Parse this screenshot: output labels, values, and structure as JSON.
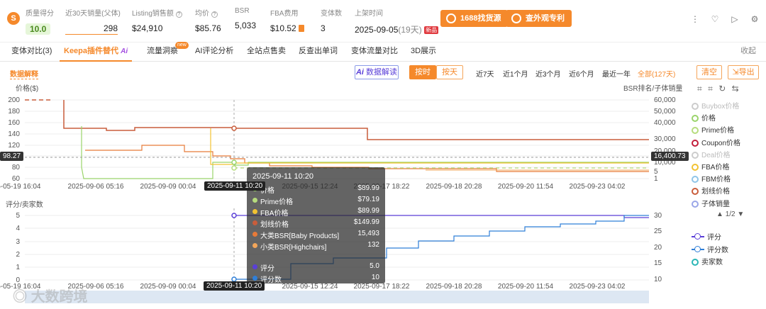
{
  "stats": {
    "logo": "S",
    "quality": {
      "label": "质量得分",
      "value": "10.0"
    },
    "sales30": {
      "label": "近30天销量(父体)",
      "value": "298"
    },
    "listing_sales": {
      "label": "Listing销售额",
      "value": "$24,910"
    },
    "avg_price": {
      "label": "均价",
      "value": "$85.76"
    },
    "bsr": {
      "label": "BSR",
      "value": "5,033"
    },
    "fba": {
      "label": "FBA费用",
      "value": "$10.52"
    },
    "variants": {
      "label": "变体数",
      "value": "3"
    },
    "listed": {
      "label": "上架时间",
      "value": "2025-09-05",
      "days": "(19天)",
      "badge": "新品"
    },
    "btn_source": "1688找货源",
    "btn_patent": "查外观专利"
  },
  "tabs": [
    {
      "label": "变体对比(3)"
    },
    {
      "label": "Keepa插件替代",
      "ai": "Ai"
    },
    {
      "label": "流量洞察",
      "badge": "new"
    },
    {
      "label": "AI评论分析"
    },
    {
      "label": "全站点售卖"
    },
    {
      "label": "反查出单词"
    },
    {
      "label": "变体流量对比"
    },
    {
      "label": "3D展示"
    }
  ],
  "collapse": "收起",
  "controls": {
    "data_explain": "数据解释",
    "ai_interpret": "数据解读",
    "by_hour": "按时",
    "by_day": "按天",
    "ranges": [
      "近7天",
      "近1个月",
      "近3个月",
      "近6个月",
      "最近一年",
      "全部(127天)"
    ],
    "clear": "清空",
    "export": "导出"
  },
  "chart_top": {
    "ylabel_left": "价格($)",
    "ylabel_right": "BSR排名/子体销量",
    "yticks_left": [
      "200",
      "180",
      "160",
      "140",
      "120",
      "100",
      "80",
      "60"
    ],
    "yticks_right": [
      "60,000",
      "50,000",
      "40,000",
      "30,000",
      "20,000",
      "10,000",
      "5",
      "1"
    ],
    "marker_left": "98.27",
    "marker_right": "16,400.73",
    "xticks": [
      "2025-05-19 16:04",
      "2025-09-06 05:16",
      "2025-09-09 00:04",
      "2025-09-11 10:20",
      "2025-09-15 12:24",
      "2025-09-17 18:22",
      "2025-09-18 20:28",
      "2025-09-20 11:54",
      "2025-09-23 04:02"
    ]
  },
  "chart_bottom": {
    "ylabel_left": "评分/卖家数",
    "yticks_left": [
      "5",
      "4",
      "3",
      "2",
      "1",
      "0"
    ],
    "yticks_right": [
      "30",
      "25",
      "20",
      "15",
      "10"
    ],
    "xticks": [
      "2025-05-19 16:04",
      "2025-09-06 05:16",
      "2025-09-09 00:04",
      "2025-09-11 10:20",
      "2025-09-15 12:24",
      "2025-09-17 18:22",
      "2025-09-18 20:28",
      "2025-09-20 11:54",
      "2025-09-23 04:02"
    ]
  },
  "crosshair_label": "2025-09-11 10:20",
  "tooltip": {
    "time": "2025-09-11 10:20",
    "rows": [
      {
        "name": "价格",
        "value": "$89.99",
        "color": "#9ad46a"
      },
      {
        "name": "Prime价格",
        "value": "$79.19",
        "color": "#b6dc7d"
      },
      {
        "name": "FBA价格",
        "value": "$89.99",
        "color": "#f2c232"
      },
      {
        "name": "划线价格",
        "value": "$149.99",
        "color": "#c95d3b"
      },
      {
        "name": "大类BSR[Baby Products]",
        "value": "15,493",
        "color": "#e77a38"
      },
      {
        "name": "小类BSR[Highchairs]",
        "value": "132",
        "color": "#f2a65a"
      },
      {
        "name": "评分",
        "value": "5.0",
        "color": "#5a3fd8"
      },
      {
        "name": "评分数",
        "value": "10",
        "color": "#2f7fd8"
      }
    ]
  },
  "legend_top": [
    {
      "name": "Buybox价格",
      "color": "#cccccc",
      "muted": true
    },
    {
      "name": "价格",
      "color": "#9ad46a",
      "muted": false
    },
    {
      "name": "Prime价格",
      "color": "#b6dc7d",
      "muted": false
    },
    {
      "name": "Coupon价格",
      "color": "#c21d3a",
      "muted": false
    },
    {
      "name": "Deal价格",
      "color": "#cccccc",
      "muted": true
    },
    {
      "name": "FBA价格",
      "color": "#f2c232",
      "muted": false
    },
    {
      "name": "FBM价格",
      "color": "#8fc5e8",
      "muted": false
    },
    {
      "name": "划线价格",
      "color": "#c95d3b",
      "muted": false
    },
    {
      "name": "子体销量",
      "color": "#9aa6e8",
      "muted": false
    }
  ],
  "legend_pager": "1/2",
  "legend_bottom": [
    {
      "name": "评分",
      "color": "#5a3fd8"
    },
    {
      "name": "评分数",
      "color": "#2f7fd8"
    },
    {
      "name": "卖家数",
      "color": "#2ab6b6"
    }
  ],
  "watermark": "大数跨境",
  "chart_data": [
    {
      "type": "line",
      "title": "",
      "xlabel": "",
      "ylabel": "价格($)",
      "y2label": "BSR排名/子体销量",
      "ylim": [
        60,
        200
      ],
      "x": [
        "2025-05-19 16:04",
        "2025-09-06 05:16",
        "2025-09-09 00:04",
        "2025-09-11 10:20",
        "2025-09-15 12:24",
        "2025-09-17 18:22",
        "2025-09-18 20:28",
        "2025-09-20 11:54",
        "2025-09-23 04:02"
      ],
      "series": [
        {
          "name": "划线价格",
          "color": "#c95d3b",
          "values": [
            200,
            150,
            150,
            149.99,
            149.99,
            130,
            130,
            130,
            130
          ]
        },
        {
          "name": "价格",
          "color": "#9ad46a",
          "values": [
            200,
            65,
            65,
            89.99,
            89.99,
            89.99,
            89.99,
            89.99,
            89.99
          ]
        },
        {
          "name": "FBA价格",
          "color": "#f2c232",
          "values": [
            null,
            null,
            150,
            89.99,
            89.99,
            89.99,
            89.99,
            89.99,
            89.99
          ]
        },
        {
          "name": "Prime价格",
          "color": "#b6dc7d",
          "values": [
            null,
            null,
            null,
            79.19,
            79.19,
            79.19,
            79.19,
            79.19,
            79.19
          ]
        },
        {
          "name": "大类BSR[Baby Products]",
          "color": "#e77a38",
          "values": [
            30000,
            25000,
            22000,
            15493,
            14000,
            14000,
            11000,
            10000,
            9000
          ]
        },
        {
          "name": "小类BSR[Highchairs]",
          "color": "#f2a65a",
          "values": [
            null,
            null,
            null,
            132,
            120,
            110,
            100,
            95,
            90
          ]
        }
      ]
    },
    {
      "type": "line",
      "title": "",
      "xlabel": "",
      "ylabel": "评分/卖家数",
      "y2label": "评分数",
      "ylim": [
        0,
        5
      ],
      "x": [
        "2025-09-11 10:20",
        "2025-09-15 12:24",
        "2025-09-17 18:22",
        "2025-09-18 20:28",
        "2025-09-20 11:54",
        "2025-09-23 04:02"
      ],
      "series": [
        {
          "name": "评分",
          "color": "#5a3fd8",
          "values": [
            5.0,
            5.0,
            5.0,
            5.0,
            4.9,
            4.9
          ]
        },
        {
          "name": "评分数",
          "color": "#2f7fd8",
          "values": [
            10,
            13,
            19,
            24,
            27,
            30
          ]
        }
      ]
    }
  ]
}
